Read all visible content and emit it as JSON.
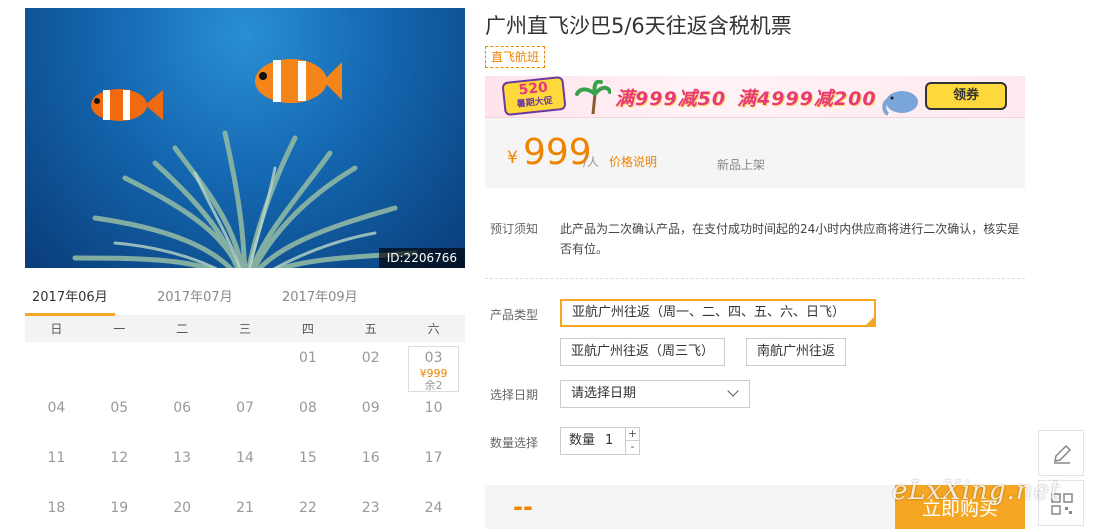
{
  "product": {
    "title": "广州直飞沙巴5/6天往返含税机票",
    "tag": "直飞航班",
    "image_id": "ID:2206766"
  },
  "banner": {
    "badge_num": "520",
    "badge_sub": "暑期大促",
    "promo1": "满999减50",
    "promo2": "满4999减200",
    "coupon": "领券"
  },
  "price": {
    "currency": "¥",
    "amount": "999",
    "unit": "/人",
    "explain": "价格说明",
    "new_listing": "新品上架"
  },
  "notice": {
    "label": "预订须知",
    "text": "此产品为二次确认产品，在支付成功时间起的24小时内供应商将进行二次确认，核实是否有位。"
  },
  "options": {
    "type_label": "产品类型",
    "types": [
      "亚航广州往返（周一、二、四、五、六、日飞）",
      "亚航广州往返（周三飞）",
      "南航广州往返"
    ],
    "date_label": "选择日期",
    "date_placeholder": "请选择日期",
    "qty_label": "数量选择",
    "qty_text": "数量",
    "qty_value": "1",
    "qty_plus": "+",
    "qty_minus": "-"
  },
  "calendar": {
    "months": [
      "2017年06月",
      "2017年07月",
      "2017年09月"
    ],
    "active_month": 0,
    "weekdays": [
      "日",
      "一",
      "二",
      "三",
      "四",
      "五",
      "六"
    ],
    "days": [
      "",
      "",
      "",
      "",
      "01",
      "02",
      "03",
      "04",
      "05",
      "06",
      "07",
      "08",
      "09",
      "10",
      "11",
      "12",
      "13",
      "14",
      "15",
      "16",
      "17",
      "18",
      "19",
      "20",
      "21",
      "22",
      "23",
      "24"
    ],
    "available": {
      "index": 6,
      "price": "¥999",
      "stock": "余2"
    }
  },
  "buy": {
    "total": "--",
    "button": "立即购买"
  },
  "watermark": "eLxXing.net",
  "colors": {
    "accent": "#f5a623",
    "price": "#f08300"
  }
}
